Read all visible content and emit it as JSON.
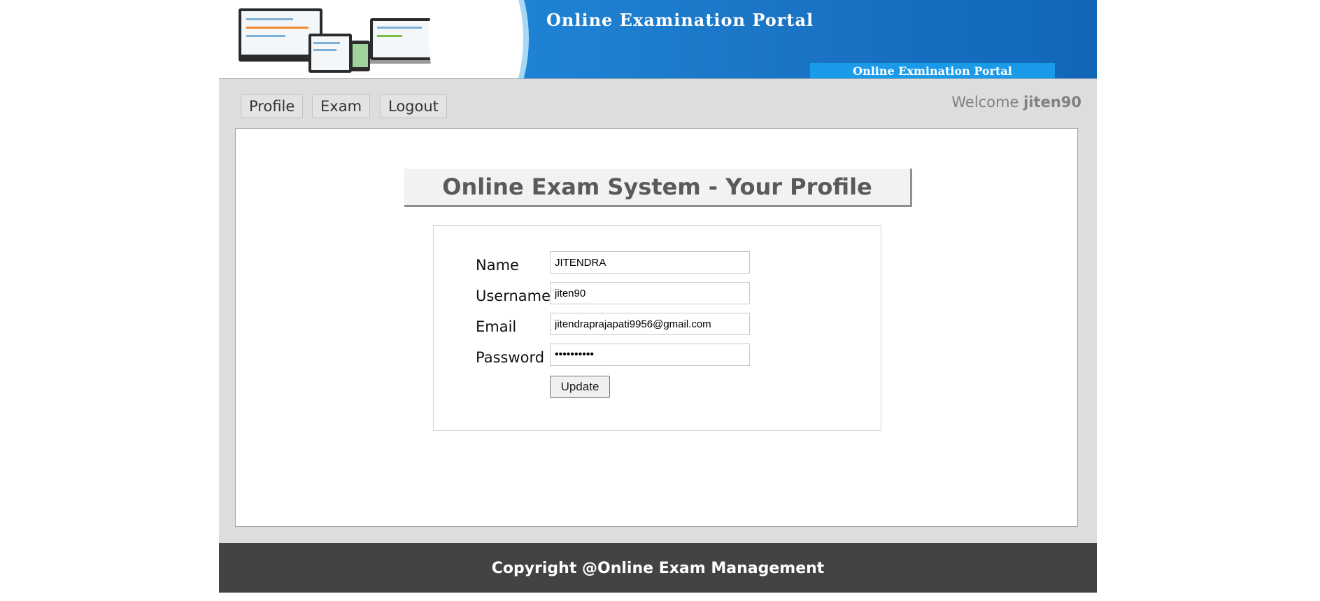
{
  "header": {
    "banner_title": "Online Examination Portal",
    "banner_subtitle": "Online Exmination Portal"
  },
  "nav": {
    "items": [
      {
        "label": "Profile"
      },
      {
        "label": "Exam"
      },
      {
        "label": "Logout"
      }
    ],
    "welcome_prefix": "Welcome",
    "username": "jiten90"
  },
  "profile": {
    "heading": "Online Exam System - Your Profile",
    "fields": {
      "name": {
        "label": "Name",
        "value": "JITENDRA"
      },
      "username": {
        "label": "Username",
        "value": "jiten90"
      },
      "email": {
        "label": "Email",
        "value": "jitendraprajapati9956@gmail.com"
      },
      "password": {
        "label": "Password",
        "value": "••••••••••"
      }
    },
    "update_label": "Update"
  },
  "footer": {
    "text": "Copyright @Online Exam Management"
  },
  "colors": {
    "banner_blue": "#1a73c4",
    "page_bg": "#dddddd",
    "footer_bg": "#434343",
    "heading_text": "#5a5a5a"
  }
}
